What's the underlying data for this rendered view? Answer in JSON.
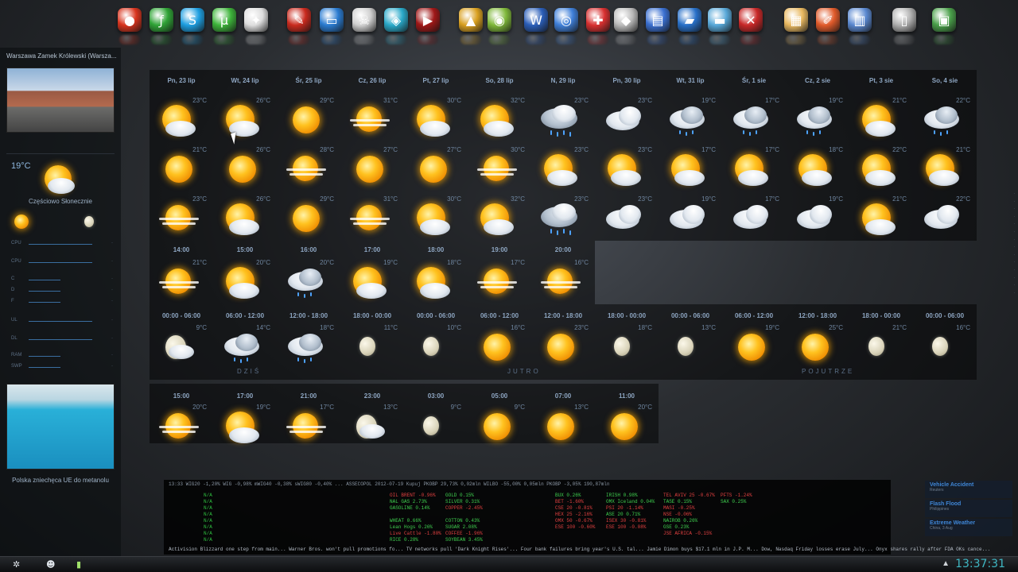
{
  "sidebar": {
    "title": "Warszawa Zamek Królewski (Warsza...",
    "temperature": "19°C",
    "condition": "Częściowo Słonecznie",
    "caption": "Polska zniechęca UE do metanolu"
  },
  "weather": {
    "days": [
      {
        "label": "Pn, 23 lip",
        "rows": [
          {
            "icon": "sun-cloud",
            "t": "23°C"
          },
          {
            "icon": "sun",
            "t": "21°C"
          },
          {
            "icon": "sun-haze",
            "t": "23°C"
          }
        ]
      },
      {
        "label": "Wt, 24 lip",
        "rows": [
          {
            "icon": "sun-cloud",
            "t": "26°C"
          },
          {
            "icon": "sun",
            "t": "26°C"
          },
          {
            "icon": "sun-cloud",
            "t": "26°C"
          }
        ]
      },
      {
        "label": "Śr, 25 lip",
        "rows": [
          {
            "icon": "sun",
            "t": "29°C"
          },
          {
            "icon": "sun-haze",
            "t": "28°C"
          },
          {
            "icon": "sun",
            "t": "29°C"
          }
        ]
      },
      {
        "label": "Cz, 26 lip",
        "rows": [
          {
            "icon": "sun-haze",
            "t": "31°C"
          },
          {
            "icon": "sun",
            "t": "27°C"
          },
          {
            "icon": "sun-haze",
            "t": "31°C"
          }
        ]
      },
      {
        "label": "Pt, 27 lip",
        "rows": [
          {
            "icon": "sun-cloud",
            "t": "30°C"
          },
          {
            "icon": "sun",
            "t": "27°C"
          },
          {
            "icon": "sun-cloud",
            "t": "30°C"
          }
        ]
      },
      {
        "label": "So, 28 lip",
        "rows": [
          {
            "icon": "sun-cloud",
            "t": "32°C"
          },
          {
            "icon": "sun-haze",
            "t": "30°C"
          },
          {
            "icon": "sun-cloud",
            "t": "32°C"
          }
        ]
      },
      {
        "label": "N, 29 lip",
        "rows": [
          {
            "icon": "storm",
            "t": "23°C"
          },
          {
            "icon": "sun-cloud",
            "t": "23°C"
          },
          {
            "icon": "storm",
            "t": "23°C"
          }
        ]
      },
      {
        "label": "Pn, 30 lip",
        "rows": [
          {
            "icon": "cloud",
            "t": "23°C"
          },
          {
            "icon": "sun-cloud",
            "t": "23°C"
          },
          {
            "icon": "cloud",
            "t": "23°C"
          }
        ]
      },
      {
        "label": "Wt, 31 lip",
        "rows": [
          {
            "icon": "rain",
            "t": "19°C"
          },
          {
            "icon": "sun-cloud",
            "t": "17°C"
          },
          {
            "icon": "cloud",
            "t": "19°C"
          }
        ]
      },
      {
        "label": "Śr, 1 sie",
        "rows": [
          {
            "icon": "rain",
            "t": "17°C"
          },
          {
            "icon": "sun-cloud",
            "t": "17°C"
          },
          {
            "icon": "cloud",
            "t": "17°C"
          }
        ]
      },
      {
        "label": "Cz, 2 sie",
        "rows": [
          {
            "icon": "rain",
            "t": "19°C"
          },
          {
            "icon": "sun-cloud",
            "t": "18°C"
          },
          {
            "icon": "cloud",
            "t": "19°C"
          }
        ]
      },
      {
        "label": "Pt, 3 sie",
        "rows": [
          {
            "icon": "sun-cloud",
            "t": "21°C"
          },
          {
            "icon": "sun-cloud",
            "t": "22°C"
          },
          {
            "icon": "sun-cloud",
            "t": "21°C"
          }
        ]
      },
      {
        "label": "So, 4 sie",
        "rows": [
          {
            "icon": "rain",
            "t": "22°C"
          },
          {
            "icon": "sun-cloud",
            "t": "21°C"
          },
          {
            "icon": "cloud",
            "t": "22°C"
          }
        ]
      }
    ],
    "hourly": [
      {
        "time": "14:00",
        "icon": "sun-haze",
        "t": "21°C"
      },
      {
        "time": "15:00",
        "icon": "sun-cloud",
        "t": "20°C"
      },
      {
        "time": "16:00",
        "icon": "rain",
        "t": "20°C"
      },
      {
        "time": "17:00",
        "icon": "sun-cloud",
        "t": "19°C"
      },
      {
        "time": "18:00",
        "icon": "sun-cloud",
        "t": "18°C"
      },
      {
        "time": "19:00",
        "icon": "sun-haze",
        "t": "17°C"
      },
      {
        "time": "20:00",
        "icon": "sun-haze",
        "t": "16°C"
      }
    ],
    "periods": [
      {
        "time": "00:00 - 06:00",
        "icon": "moon-cloud",
        "t": "9°C"
      },
      {
        "time": "06:00 - 12:00",
        "icon": "rain",
        "t": "14°C"
      },
      {
        "time": "12:00 - 18:00",
        "icon": "rain",
        "t": "18°C"
      },
      {
        "time": "18:00 - 00:00",
        "icon": "moon",
        "t": "11°C"
      },
      {
        "time": "00:00 - 06:00",
        "icon": "moon",
        "t": "10°C"
      },
      {
        "time": "06:00 - 12:00",
        "icon": "sun",
        "t": "16°C"
      },
      {
        "time": "12:00 - 18:00",
        "icon": "sun",
        "t": "23°C"
      },
      {
        "time": "18:00 - 00:00",
        "icon": "moon",
        "t": "18°C"
      },
      {
        "time": "00:00 - 06:00",
        "icon": "moon",
        "t": "13°C"
      },
      {
        "time": "06:00 - 12:00",
        "icon": "sun",
        "t": "19°C"
      },
      {
        "time": "12:00 - 18:00",
        "icon": "sun",
        "t": "25°C"
      },
      {
        "time": "18:00 - 00:00",
        "icon": "moon",
        "t": "21°C"
      },
      {
        "time": "00:00 - 06:00",
        "icon": "moon",
        "t": "16°C"
      }
    ],
    "sections": [
      "DZIŚ",
      "JUTRO",
      "POJUTRZE"
    ],
    "lower": [
      {
        "time": "15:00",
        "icon": "sun-haze",
        "t": "20°C"
      },
      {
        "time": "17:00",
        "icon": "sun-cloud",
        "t": "19°C"
      },
      {
        "time": "21:00",
        "icon": "sun-haze",
        "t": "17°C"
      },
      {
        "time": "23:00",
        "icon": "moon-cloud",
        "t": "13°C"
      },
      {
        "time": "03:00",
        "icon": "moon",
        "t": "9°C"
      },
      {
        "time": "05:00",
        "icon": "sun",
        "t": "9°C"
      },
      {
        "time": "07:00",
        "icon": "sun",
        "t": "13°C"
      },
      {
        "time": "11:00",
        "icon": "sun",
        "t": "20°C"
      }
    ]
  },
  "ticker": {
    "head": "13:33   WIG20  -1,20%  WIG  -0,98%  mWIG40  -0,38%  sWIG80  -0,40%   ...   ASSECOPOL  2012-07-19  Kupuj   PKOBP  29,73%  0,02mln   WILBO  -55,00%  0,05mln   PKOBP  -3,05%  190,87mln",
    "col1": [
      "N/A",
      "N/A",
      "N/A",
      "N/A",
      "N/A",
      "N/A",
      "N/A",
      "N/A"
    ],
    "col2": [
      "OIL BRENT  -0.96%",
      "NAL GAS  2.73%",
      "GASOLINE  0.14%",
      "",
      "WHEAT  0.66%",
      "Lean Hogs  0.26%",
      "Live Cattle  -1.80%",
      "RICE  0.28%"
    ],
    "col3": [
      "GOLD  0.15%",
      "SILVER  0.31%",
      "COPPER  -2.45%",
      "",
      "COTTON  0.43%",
      "SUGAR  2.08%",
      "COFFEE  -1.96%",
      "SOYBEAN  3.45%"
    ],
    "col4": [
      "BUX  0.26%",
      "BET  -1.60%",
      "CSE 20  -0.81%",
      "HEX 25  -2.16%",
      "OMX 50  -0.67%",
      "ESE 100  -0.60%"
    ],
    "col5": [
      "IRISH  0.98%",
      "OMX Iceland  0.04%",
      "PSI 20  -1.14%",
      "ASE 20  0.71%",
      "ISEX 30  -0.81%",
      "ESE 100  -0.08%"
    ],
    "col6": [
      "TEL AVIV 25  -0.67%",
      "TASE  0.15%",
      "MASI  -0.25%",
      "NSE  -0.06%",
      "NAIROB  0.26%",
      "GSE  0.23%",
      "JSE AFRICA  -0.15%"
    ],
    "col7": [
      "PFTS  -1.24%",
      "SAX  0.25%"
    ],
    "news": "Activision Blizzard one step from main...   Warner Bros. won't pull promotions fo...   TV networks pull 'Dark Knight Rises'...   Four bank failures bring year's U.S. tal...   Jamie Dimon buys $17.1 mln in J.P. M...   Dow, Nasdaq Friday losses erase July...   Onyx shares rally after FDA OKs cance..."
  },
  "alerts": [
    {
      "title": "Vehicle Accident",
      "sub": "Reuters"
    },
    {
      "title": "Flash Flood",
      "sub": "Philippines"
    },
    {
      "title": "Extreme Weather",
      "sub": "China, 3 Aug"
    }
  ],
  "taskbar": {
    "clock": "13:37:31"
  }
}
